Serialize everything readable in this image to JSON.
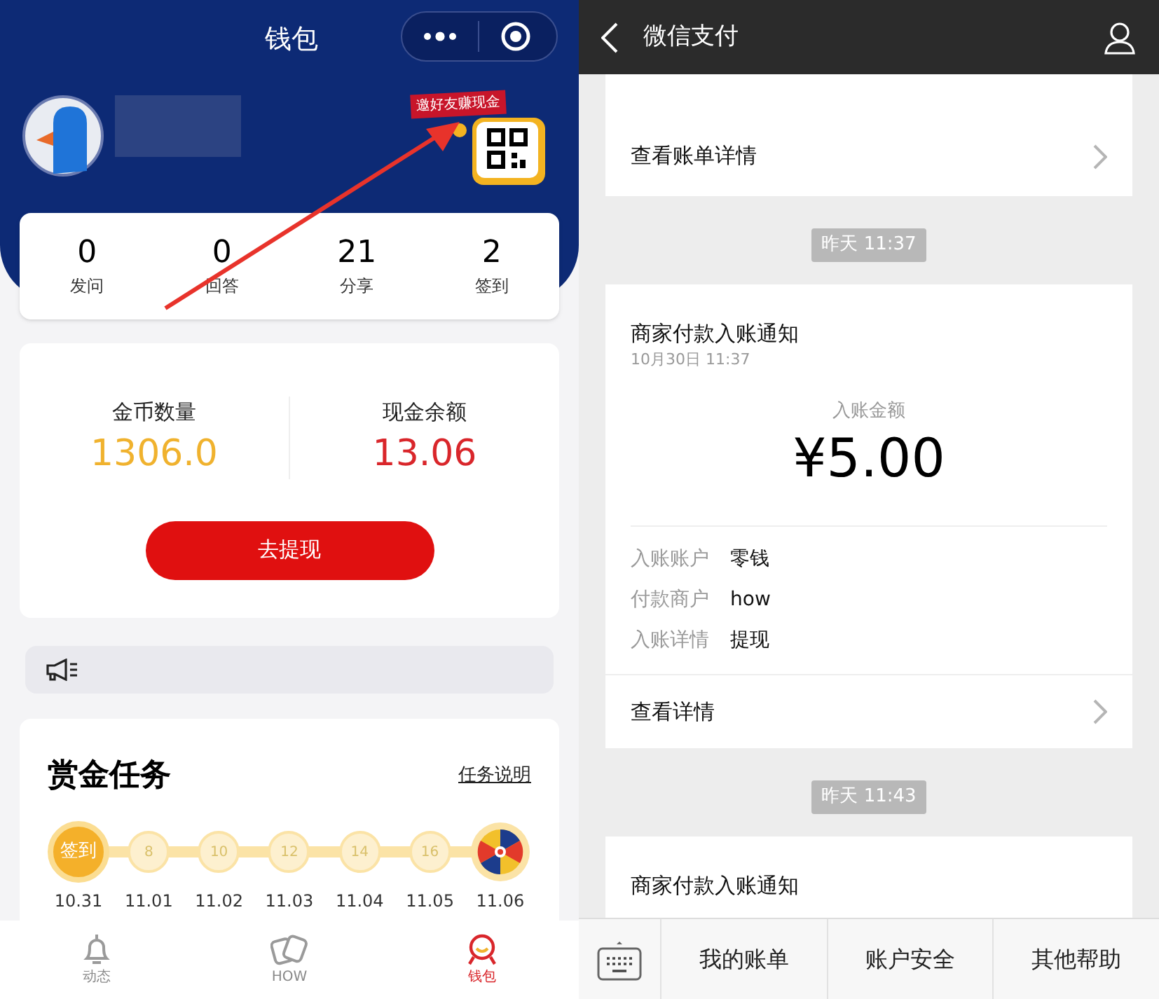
{
  "left": {
    "title": "钱包",
    "invite_banner": "邀好友赚现金",
    "stats": [
      {
        "value": "0",
        "label": "发问"
      },
      {
        "value": "0",
        "label": "回答"
      },
      {
        "value": "21",
        "label": "分享"
      },
      {
        "value": "2",
        "label": "签到"
      }
    ],
    "balances": [
      {
        "label": "金币数量",
        "value": "1306.0",
        "color": "#f0b22e"
      },
      {
        "label": "现金余额",
        "value": "13.06",
        "color": "#d9262b"
      }
    ],
    "withdraw_button": "去提现",
    "tasks": {
      "title": "赏金任务",
      "link": "任务说明",
      "steps": [
        {
          "kind": "checkin",
          "label": "签到",
          "date": "10.31",
          "selected": true
        },
        {
          "kind": "coin",
          "label": "8",
          "date": "11.01",
          "selected": false
        },
        {
          "kind": "coin",
          "label": "10",
          "date": "11.02",
          "selected": false
        },
        {
          "kind": "coin",
          "label": "12",
          "date": "11.03",
          "selected": false
        },
        {
          "kind": "coin",
          "label": "14",
          "date": "11.04",
          "selected": false
        },
        {
          "kind": "coin",
          "label": "16",
          "date": "11.05",
          "selected": false
        },
        {
          "kind": "wheel",
          "date": "11.06",
          "selected": false
        }
      ]
    },
    "tabs": [
      {
        "label": "动态",
        "kind": "bell",
        "selected": false
      },
      {
        "label": "HOW",
        "kind": "cards",
        "selected": false
      },
      {
        "label": "钱包",
        "kind": "wallet",
        "selected": true
      }
    ]
  },
  "right": {
    "title": "微信支付",
    "bill_link": "查看账单详情",
    "messages": [
      {
        "time": "昨天 11:37",
        "title": "商家付款入账通知",
        "date": "10月30日 11:37",
        "amount_label": "入账金额",
        "amount": "¥5.00",
        "rows": [
          {
            "label": "入账账户",
            "value": "零钱"
          },
          {
            "label": "付款商户",
            "value": "how"
          },
          {
            "label": "入账详情",
            "value": "提现"
          }
        ],
        "link": "查看详情"
      },
      {
        "time": "昨天 11:43",
        "title": "商家付款入账通知"
      }
    ],
    "menu": [
      "我的账单",
      "账户安全",
      "其他帮助"
    ]
  }
}
